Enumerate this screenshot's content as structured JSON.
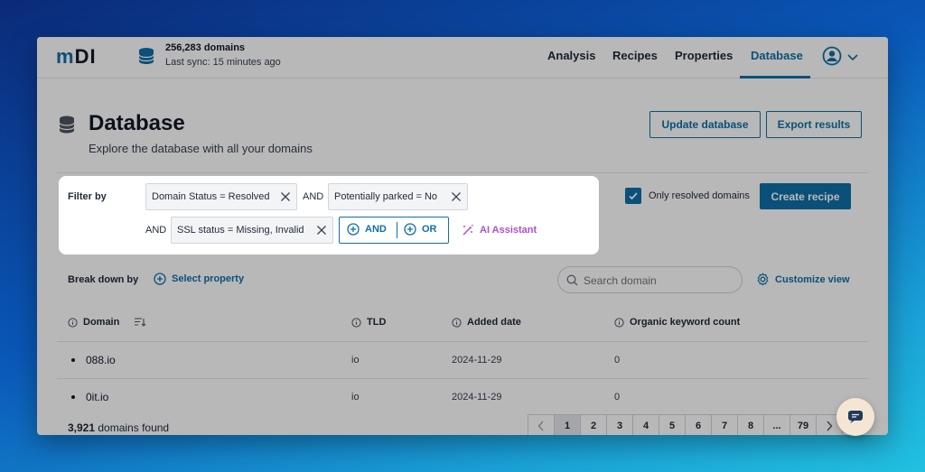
{
  "header": {
    "logo_left": "m",
    "logo_mid": "D",
    "logo_right": "I",
    "sync_count": "256,283 domains",
    "sync_time": "Last sync: 15 minutes ago",
    "nav": [
      "Analysis",
      "Recipes",
      "Properties",
      "Database"
    ],
    "active_nav": "Database"
  },
  "page": {
    "title": "Database",
    "subtitle": "Explore the database with all your domains",
    "update_button": "Update database",
    "export_button": "Export results"
  },
  "filters": {
    "label": "Filter by",
    "chips": [
      "Domain Status = Resolved",
      "Potentially parked = No",
      "SSL status = Missing, Invalid"
    ],
    "op_and_1": "AND",
    "op_and_2": "AND",
    "add_and": "AND",
    "add_or": "OR",
    "ai_assistant": "AI Assistant"
  },
  "options": {
    "only_resolved": "Only resolved domains",
    "only_resolved_checked": true,
    "create_recipe": "Create recipe"
  },
  "toolbar": {
    "breakdown_label": "Break down by",
    "select_property": "Select property",
    "search_placeholder": "Search domain",
    "customize_view": "Customize view"
  },
  "table": {
    "columns": [
      "Domain",
      "TLD",
      "Added date",
      "Organic keyword count"
    ],
    "rows": [
      {
        "domain": "088.io",
        "tld": "io",
        "added": "2024-11-29",
        "keywords": "0"
      },
      {
        "domain": "0it.io",
        "tld": "io",
        "added": "2024-11-29",
        "keywords": "0"
      }
    ]
  },
  "footer": {
    "found_count": "3,921",
    "found_text": "domains found",
    "pages": [
      "1",
      "2",
      "3",
      "4",
      "5",
      "6",
      "7",
      "8",
      "...",
      "79"
    ],
    "current_page": "1"
  },
  "colors": {
    "accent": "#0f6fa8",
    "ai": "#b04fcf"
  }
}
